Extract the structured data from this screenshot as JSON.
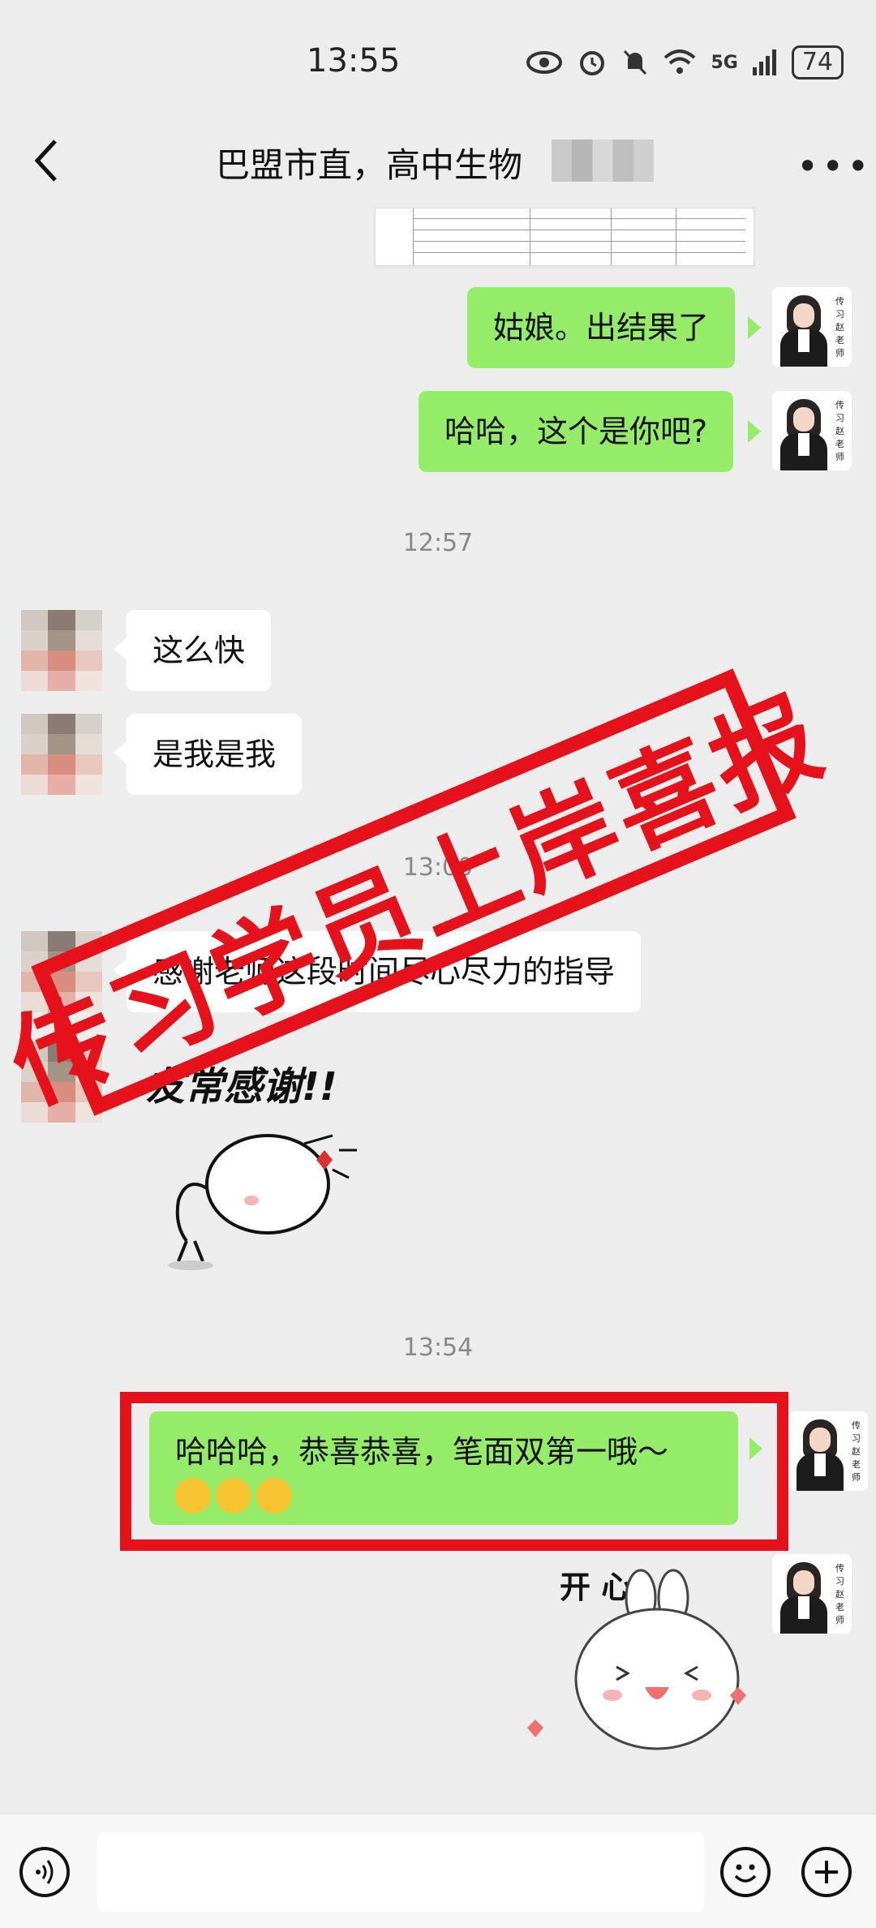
{
  "status_bar": {
    "time": "13:55",
    "battery": "74",
    "network": "5G"
  },
  "header": {
    "title": "巴盟市直，高中生物"
  },
  "messages": {
    "m1": "姑娘。出结果了",
    "m2": "哈哈，这个是你吧?",
    "m3": "这么快",
    "m4": "是我是我",
    "m5": "感谢老师这段时间尽心尽力的指导",
    "m6": "哈哈哈，恭喜恭喜，笔面双第一哦～"
  },
  "timestamps": {
    "t1": "12:57",
    "t2": "13:00",
    "t3": "13:54"
  },
  "stickers": {
    "thanks_text": "友常感谢!!",
    "happy_text": "开  心"
  },
  "teacher_avatar_sig": "传习赵老师",
  "stamp": {
    "text": "传习学员上岸喜报",
    "color": "#e5121b"
  },
  "colors": {
    "green_bubble": "#95ec69",
    "background": "#ededed"
  },
  "icons": {
    "back": "chevron-left-icon",
    "more": "more-dots-icon",
    "voice": "voice-icon",
    "emoji": "emoji-icon",
    "plus": "plus-icon"
  }
}
